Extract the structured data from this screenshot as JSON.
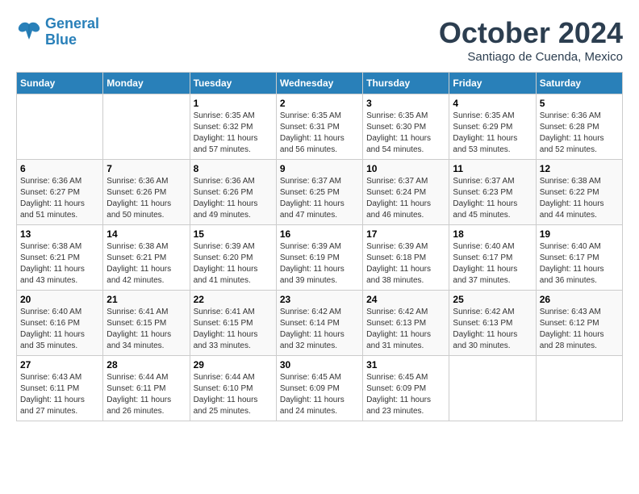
{
  "header": {
    "logo": {
      "line1": "General",
      "line2": "Blue"
    },
    "title": "October 2024",
    "location": "Santiago de Cuenda, Mexico"
  },
  "weekdays": [
    "Sunday",
    "Monday",
    "Tuesday",
    "Wednesday",
    "Thursday",
    "Friday",
    "Saturday"
  ],
  "weeks": [
    [
      {
        "day": "",
        "info": ""
      },
      {
        "day": "",
        "info": ""
      },
      {
        "day": "1",
        "info": "Sunrise: 6:35 AM\nSunset: 6:32 PM\nDaylight: 11 hours and 57 minutes."
      },
      {
        "day": "2",
        "info": "Sunrise: 6:35 AM\nSunset: 6:31 PM\nDaylight: 11 hours and 56 minutes."
      },
      {
        "day": "3",
        "info": "Sunrise: 6:35 AM\nSunset: 6:30 PM\nDaylight: 11 hours and 54 minutes."
      },
      {
        "day": "4",
        "info": "Sunrise: 6:35 AM\nSunset: 6:29 PM\nDaylight: 11 hours and 53 minutes."
      },
      {
        "day": "5",
        "info": "Sunrise: 6:36 AM\nSunset: 6:28 PM\nDaylight: 11 hours and 52 minutes."
      }
    ],
    [
      {
        "day": "6",
        "info": "Sunrise: 6:36 AM\nSunset: 6:27 PM\nDaylight: 11 hours and 51 minutes."
      },
      {
        "day": "7",
        "info": "Sunrise: 6:36 AM\nSunset: 6:26 PM\nDaylight: 11 hours and 50 minutes."
      },
      {
        "day": "8",
        "info": "Sunrise: 6:36 AM\nSunset: 6:26 PM\nDaylight: 11 hours and 49 minutes."
      },
      {
        "day": "9",
        "info": "Sunrise: 6:37 AM\nSunset: 6:25 PM\nDaylight: 11 hours and 47 minutes."
      },
      {
        "day": "10",
        "info": "Sunrise: 6:37 AM\nSunset: 6:24 PM\nDaylight: 11 hours and 46 minutes."
      },
      {
        "day": "11",
        "info": "Sunrise: 6:37 AM\nSunset: 6:23 PM\nDaylight: 11 hours and 45 minutes."
      },
      {
        "day": "12",
        "info": "Sunrise: 6:38 AM\nSunset: 6:22 PM\nDaylight: 11 hours and 44 minutes."
      }
    ],
    [
      {
        "day": "13",
        "info": "Sunrise: 6:38 AM\nSunset: 6:21 PM\nDaylight: 11 hours and 43 minutes."
      },
      {
        "day": "14",
        "info": "Sunrise: 6:38 AM\nSunset: 6:21 PM\nDaylight: 11 hours and 42 minutes."
      },
      {
        "day": "15",
        "info": "Sunrise: 6:39 AM\nSunset: 6:20 PM\nDaylight: 11 hours and 41 minutes."
      },
      {
        "day": "16",
        "info": "Sunrise: 6:39 AM\nSunset: 6:19 PM\nDaylight: 11 hours and 39 minutes."
      },
      {
        "day": "17",
        "info": "Sunrise: 6:39 AM\nSunset: 6:18 PM\nDaylight: 11 hours and 38 minutes."
      },
      {
        "day": "18",
        "info": "Sunrise: 6:40 AM\nSunset: 6:17 PM\nDaylight: 11 hours and 37 minutes."
      },
      {
        "day": "19",
        "info": "Sunrise: 6:40 AM\nSunset: 6:17 PM\nDaylight: 11 hours and 36 minutes."
      }
    ],
    [
      {
        "day": "20",
        "info": "Sunrise: 6:40 AM\nSunset: 6:16 PM\nDaylight: 11 hours and 35 minutes."
      },
      {
        "day": "21",
        "info": "Sunrise: 6:41 AM\nSunset: 6:15 PM\nDaylight: 11 hours and 34 minutes."
      },
      {
        "day": "22",
        "info": "Sunrise: 6:41 AM\nSunset: 6:15 PM\nDaylight: 11 hours and 33 minutes."
      },
      {
        "day": "23",
        "info": "Sunrise: 6:42 AM\nSunset: 6:14 PM\nDaylight: 11 hours and 32 minutes."
      },
      {
        "day": "24",
        "info": "Sunrise: 6:42 AM\nSunset: 6:13 PM\nDaylight: 11 hours and 31 minutes."
      },
      {
        "day": "25",
        "info": "Sunrise: 6:42 AM\nSunset: 6:13 PM\nDaylight: 11 hours and 30 minutes."
      },
      {
        "day": "26",
        "info": "Sunrise: 6:43 AM\nSunset: 6:12 PM\nDaylight: 11 hours and 28 minutes."
      }
    ],
    [
      {
        "day": "27",
        "info": "Sunrise: 6:43 AM\nSunset: 6:11 PM\nDaylight: 11 hours and 27 minutes."
      },
      {
        "day": "28",
        "info": "Sunrise: 6:44 AM\nSunset: 6:11 PM\nDaylight: 11 hours and 26 minutes."
      },
      {
        "day": "29",
        "info": "Sunrise: 6:44 AM\nSunset: 6:10 PM\nDaylight: 11 hours and 25 minutes."
      },
      {
        "day": "30",
        "info": "Sunrise: 6:45 AM\nSunset: 6:09 PM\nDaylight: 11 hours and 24 minutes."
      },
      {
        "day": "31",
        "info": "Sunrise: 6:45 AM\nSunset: 6:09 PM\nDaylight: 11 hours and 23 minutes."
      },
      {
        "day": "",
        "info": ""
      },
      {
        "day": "",
        "info": ""
      }
    ]
  ]
}
